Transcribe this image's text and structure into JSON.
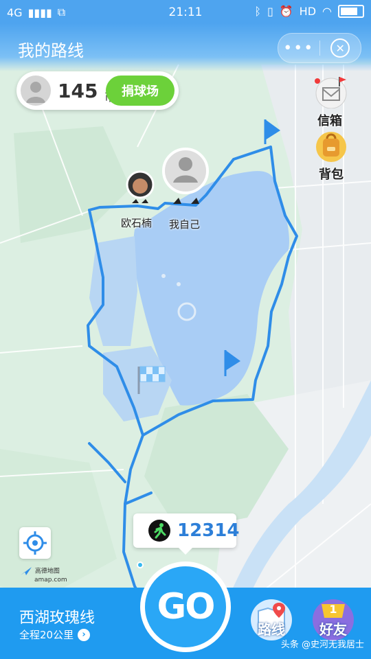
{
  "status_bar": {
    "network": "4G",
    "time": "21:11",
    "hd": "HD"
  },
  "header": {
    "title": "我的路线",
    "more_icon": "more-dots-icon",
    "close_icon": "close-icon"
  },
  "coins": {
    "amount": "145",
    "unit": "币",
    "donate_label": "捐球场"
  },
  "side_buttons": {
    "mailbox_label": "信箱",
    "backpack_label": "背包"
  },
  "map": {
    "friend_label": "欧石楠",
    "self_label": "我自己",
    "provider": "高德地图",
    "provider_domain": "amap.com"
  },
  "steps": {
    "count": "12314"
  },
  "route": {
    "name": "西湖玫瑰线",
    "distance": "全程20公里"
  },
  "go_label": "GO",
  "bottom_buttons": {
    "route_label": "路线",
    "friends_label": "好友",
    "friends_badge": "1"
  },
  "watermark": "头条 @史河无我居士",
  "colors": {
    "route": "#2f8de8",
    "lake": "#a9cdf5",
    "land": "#dcefe2",
    "primary": "#1f9bf0",
    "accent_green": "#6cd13a"
  }
}
